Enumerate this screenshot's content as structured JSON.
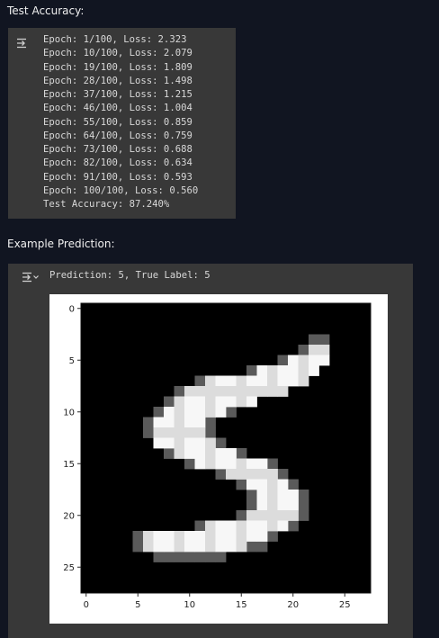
{
  "training": {
    "heading": "Test Accuracy:",
    "output_icon": "collapse-output-icon",
    "lines": [
      "Epoch: 1/100, Loss: 2.323",
      "Epoch: 10/100, Loss: 2.079",
      "Epoch: 19/100, Loss: 1.809",
      "Epoch: 28/100, Loss: 1.498",
      "Epoch: 37/100, Loss: 1.215",
      "Epoch: 46/100, Loss: 1.004",
      "Epoch: 55/100, Loss: 0.859",
      "Epoch: 64/100, Loss: 0.759",
      "Epoch: 73/100, Loss: 0.688",
      "Epoch: 82/100, Loss: 0.634",
      "Epoch: 91/100, Loss: 0.593",
      "Epoch: 100/100, Loss: 0.560",
      "Test Accuracy: 87.240%"
    ]
  },
  "prediction": {
    "heading": "Example Prediction:",
    "output_icon": "collapse-output-icon",
    "text": "Prediction: 5, True Label: 5"
  },
  "chart_data": {
    "type": "heatmap",
    "title": "",
    "colormap": "gray",
    "xlim": [
      0,
      27
    ],
    "ylim": [
      27,
      0
    ],
    "x_ticks": [
      "0",
      "5",
      "10",
      "15",
      "20",
      "25"
    ],
    "y_ticks": [
      "0",
      "5",
      "10",
      "15",
      "20",
      "25"
    ],
    "image_size": [
      28,
      28
    ],
    "stroke_pixels": [
      [
        4,
        22
      ],
      [
        4,
        23
      ],
      [
        5,
        20
      ],
      [
        5,
        21
      ],
      [
        5,
        22
      ],
      [
        5,
        23
      ],
      [
        6,
        17
      ],
      [
        6,
        18
      ],
      [
        6,
        19
      ],
      [
        6,
        20
      ],
      [
        6,
        21
      ],
      [
        6,
        22
      ],
      [
        7,
        12
      ],
      [
        7,
        13
      ],
      [
        7,
        14
      ],
      [
        7,
        15
      ],
      [
        7,
        16
      ],
      [
        7,
        17
      ],
      [
        7,
        18
      ],
      [
        7,
        19
      ],
      [
        7,
        20
      ],
      [
        7,
        21
      ],
      [
        8,
        10
      ],
      [
        8,
        11
      ],
      [
        8,
        12
      ],
      [
        8,
        13
      ],
      [
        8,
        14
      ],
      [
        8,
        15
      ],
      [
        8,
        16
      ],
      [
        8,
        17
      ],
      [
        8,
        18
      ],
      [
        8,
        19
      ],
      [
        9,
        9
      ],
      [
        9,
        10
      ],
      [
        9,
        11
      ],
      [
        9,
        12
      ],
      [
        9,
        13
      ],
      [
        9,
        14
      ],
      [
        9,
        15
      ],
      [
        9,
        16
      ],
      [
        10,
        8
      ],
      [
        10,
        9
      ],
      [
        10,
        10
      ],
      [
        10,
        11
      ],
      [
        10,
        12
      ],
      [
        10,
        13
      ],
      [
        11,
        7
      ],
      [
        11,
        8
      ],
      [
        11,
        9
      ],
      [
        11,
        10
      ],
      [
        11,
        11
      ],
      [
        12,
        7
      ],
      [
        12,
        8
      ],
      [
        12,
        9
      ],
      [
        12,
        10
      ],
      [
        12,
        11
      ],
      [
        13,
        7
      ],
      [
        13,
        8
      ],
      [
        13,
        9
      ],
      [
        13,
        10
      ],
      [
        13,
        11
      ],
      [
        13,
        12
      ],
      [
        14,
        9
      ],
      [
        14,
        10
      ],
      [
        14,
        11
      ],
      [
        14,
        12
      ],
      [
        14,
        13
      ],
      [
        14,
        14
      ],
      [
        15,
        11
      ],
      [
        15,
        12
      ],
      [
        15,
        13
      ],
      [
        15,
        14
      ],
      [
        15,
        15
      ],
      [
        15,
        16
      ],
      [
        15,
        17
      ],
      [
        16,
        14
      ],
      [
        16,
        15
      ],
      [
        16,
        16
      ],
      [
        16,
        17
      ],
      [
        16,
        18
      ],
      [
        17,
        16
      ],
      [
        17,
        17
      ],
      [
        17,
        18
      ],
      [
        17,
        19
      ],
      [
        18,
        17
      ],
      [
        18,
        18
      ],
      [
        18,
        19
      ],
      [
        18,
        20
      ],
      [
        19,
        17
      ],
      [
        19,
        18
      ],
      [
        19,
        19
      ],
      [
        19,
        20
      ],
      [
        20,
        16
      ],
      [
        20,
        17
      ],
      [
        20,
        18
      ],
      [
        20,
        19
      ],
      [
        20,
        20
      ],
      [
        21,
        12
      ],
      [
        21,
        13
      ],
      [
        21,
        14
      ],
      [
        21,
        15
      ],
      [
        21,
        16
      ],
      [
        21,
        17
      ],
      [
        21,
        18
      ],
      [
        21,
        19
      ],
      [
        22,
        6
      ],
      [
        22,
        7
      ],
      [
        22,
        8
      ],
      [
        22,
        9
      ],
      [
        22,
        10
      ],
      [
        22,
        11
      ],
      [
        22,
        12
      ],
      [
        22,
        13
      ],
      [
        22,
        14
      ],
      [
        22,
        15
      ],
      [
        22,
        16
      ],
      [
        22,
        17
      ],
      [
        23,
        6
      ],
      [
        23,
        7
      ],
      [
        23,
        8
      ],
      [
        23,
        9
      ],
      [
        23,
        10
      ],
      [
        23,
        11
      ],
      [
        23,
        12
      ],
      [
        23,
        13
      ],
      [
        23,
        14
      ],
      [
        23,
        15
      ]
    ],
    "mid_pixels": [
      [
        3,
        22
      ],
      [
        3,
        23
      ],
      [
        4,
        21
      ],
      [
        5,
        19
      ],
      [
        6,
        16
      ],
      [
        7,
        11
      ],
      [
        8,
        9
      ],
      [
        9,
        8
      ],
      [
        10,
        7
      ],
      [
        10,
        14
      ],
      [
        11,
        6
      ],
      [
        11,
        12
      ],
      [
        12,
        6
      ],
      [
        12,
        12
      ],
      [
        13,
        13
      ],
      [
        14,
        8
      ],
      [
        14,
        15
      ],
      [
        15,
        10
      ],
      [
        15,
        18
      ],
      [
        16,
        13
      ],
      [
        16,
        19
      ],
      [
        17,
        15
      ],
      [
        17,
        20
      ],
      [
        18,
        16
      ],
      [
        18,
        21
      ],
      [
        19,
        16
      ],
      [
        19,
        21
      ],
      [
        20,
        15
      ],
      [
        20,
        21
      ],
      [
        21,
        11
      ],
      [
        21,
        20
      ],
      [
        22,
        5
      ],
      [
        22,
        18
      ],
      [
        23,
        5
      ],
      [
        23,
        16
      ],
      [
        23,
        17
      ],
      [
        24,
        7
      ],
      [
        24,
        8
      ],
      [
        24,
        9
      ],
      [
        24,
        10
      ],
      [
        24,
        11
      ],
      [
        24,
        12
      ],
      [
        24,
        13
      ]
    ]
  }
}
